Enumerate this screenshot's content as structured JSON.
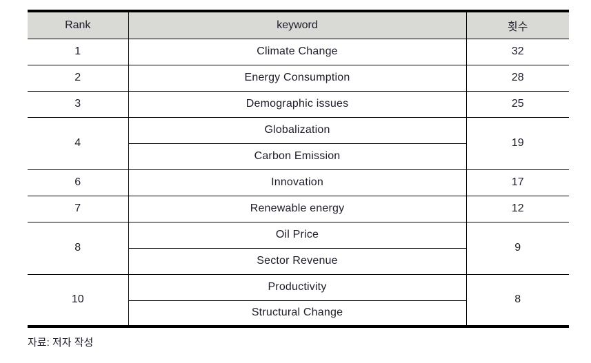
{
  "table": {
    "headers": {
      "rank": "Rank",
      "keyword": "keyword",
      "count": "횟수"
    },
    "rows": [
      {
        "rank": "1",
        "keywords": [
          "Climate Change"
        ],
        "count": "32"
      },
      {
        "rank": "2",
        "keywords": [
          "Energy Consumption"
        ],
        "count": "28"
      },
      {
        "rank": "3",
        "keywords": [
          "Demographic issues"
        ],
        "count": "25"
      },
      {
        "rank": "4",
        "keywords": [
          "Globalization",
          "Carbon Emission"
        ],
        "count": "19"
      },
      {
        "rank": "6",
        "keywords": [
          "Innovation"
        ],
        "count": "17"
      },
      {
        "rank": "7",
        "keywords": [
          "Renewable energy"
        ],
        "count": "12"
      },
      {
        "rank": "8",
        "keywords": [
          "Oil Price",
          "Sector Revenue"
        ],
        "count": "9"
      },
      {
        "rank": "10",
        "keywords": [
          "Productivity",
          "Structural Change"
        ],
        "count": "8"
      }
    ]
  },
  "source_note": "자료: 저자 작성",
  "colors": {
    "header_background": "#d9d9d6",
    "border": "#000000",
    "text": "#1c1c28",
    "page_background": "#ffffff"
  }
}
